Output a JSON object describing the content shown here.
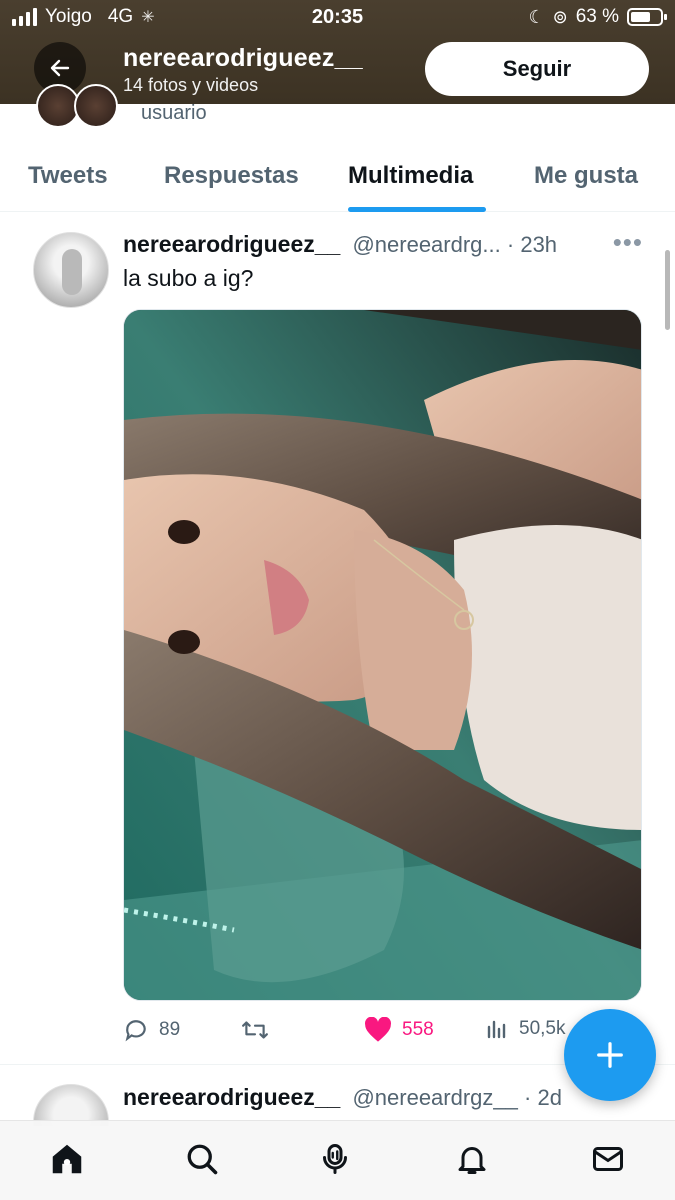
{
  "status_bar": {
    "carrier": "Yoigo",
    "network": "4G",
    "time": "20:35",
    "battery": "63 %"
  },
  "header": {
    "display_name": "nereearodrigueez__",
    "subtitle": "14 fotos y videos",
    "follow_label": "Seguir",
    "peek_text": "usuario"
  },
  "tabs": [
    {
      "label": "Tweets",
      "active": false
    },
    {
      "label": "Respuestas",
      "active": false
    },
    {
      "label": "Multimedia",
      "active": true
    },
    {
      "label": "Me gusta",
      "active": false
    }
  ],
  "tweet": {
    "name": "nereearodrigueez__",
    "handle": "@nereeardrg...",
    "separator": "·",
    "time": "23h",
    "text": "la subo a ig?",
    "replies": "89",
    "likes": "558",
    "views": "50,5k"
  },
  "tweet2": {
    "name": "nereearodrigueez__",
    "handle": "@nereeardrgz__",
    "separator": "·",
    "time": "2d"
  },
  "colors": {
    "accent": "#1d9bf0",
    "like": "#f91880",
    "secondary_text": "#536471"
  },
  "icons": {
    "back": "arrow-left-icon",
    "reply": "speech-bubble-icon",
    "retweet": "retweet-icon",
    "like": "heart-filled-icon",
    "views": "bar-chart-icon",
    "compose": "plus-icon",
    "nav": [
      "home-icon",
      "search-icon",
      "spaces-mic-icon",
      "bell-icon",
      "mail-icon"
    ]
  }
}
